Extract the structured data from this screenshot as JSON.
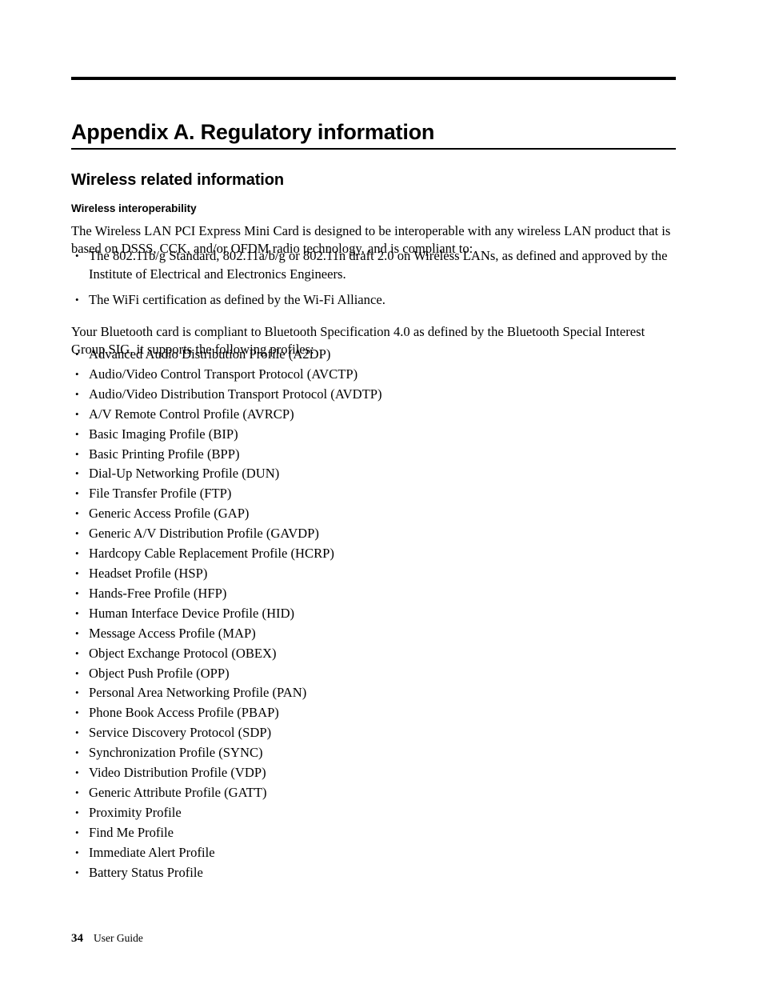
{
  "document": {
    "appendix_title": "Appendix A. Regulatory information",
    "section_heading": "Wireless related information",
    "sub_heading": "Wireless interoperability",
    "intro_paragraph": "The Wireless LAN PCI Express Mini Card is designed to be interoperable with any wireless LAN product that is based on DSSS, CCK, and/or OFDM radio technology, and is compliant to:",
    "standards_bullets": [
      "The 802.11b/g Standard, 802.11a/b/g or 802.11n draft 2.0 on Wireless LANs, as defined and approved by the Institute of Electrical and Electronics Engineers.",
      "The WiFi certification as defined by the Wi-Fi Alliance."
    ],
    "bluetooth_paragraph": "Your Bluetooth card is compliant to Bluetooth Specification 4.0 as defined by the Bluetooth Special Interest Group SIG, it supports the following profiles:",
    "profile_bullets": [
      "Advanced Audio Distribution Profile (A2DP)",
      "Audio/Video Control Transport Protocol (AVCTP)",
      "Audio/Video Distribution Transport Protocol (AVDTP)",
      "A/V Remote Control Profile (AVRCP)",
      "Basic Imaging Profile (BIP)",
      "Basic Printing Profile (BPP)",
      "Dial-Up Networking Profile (DUN)",
      "File Transfer Profile (FTP)",
      "Generic Access Profile (GAP)",
      "Generic A/V Distribution Profile (GAVDP)",
      "Hardcopy Cable Replacement Profile (HCRP)",
      "Headset Profile (HSP)",
      "Hands-Free Profile (HFP)",
      "Human Interface Device Profile (HID)",
      "Message Access Profile (MAP)",
      "Object Exchange Protocol (OBEX)",
      "Object Push Profile (OPP)",
      "Personal Area Networking Profile (PAN)",
      "Phone Book Access Profile (PBAP)",
      "Service Discovery Protocol (SDP)",
      "Synchronization Profile (SYNC)",
      "Video Distribution Profile (VDP)",
      "Generic Attribute Profile (GATT)",
      "Proximity Profile",
      "Find Me Profile",
      "Immediate Alert Profile",
      "Battery Status Profile"
    ],
    "footer": {
      "page_number": "34",
      "label": "User Guide"
    },
    "colors": {
      "text": "#000000",
      "background": "#ffffff",
      "rule": "#000000"
    }
  }
}
